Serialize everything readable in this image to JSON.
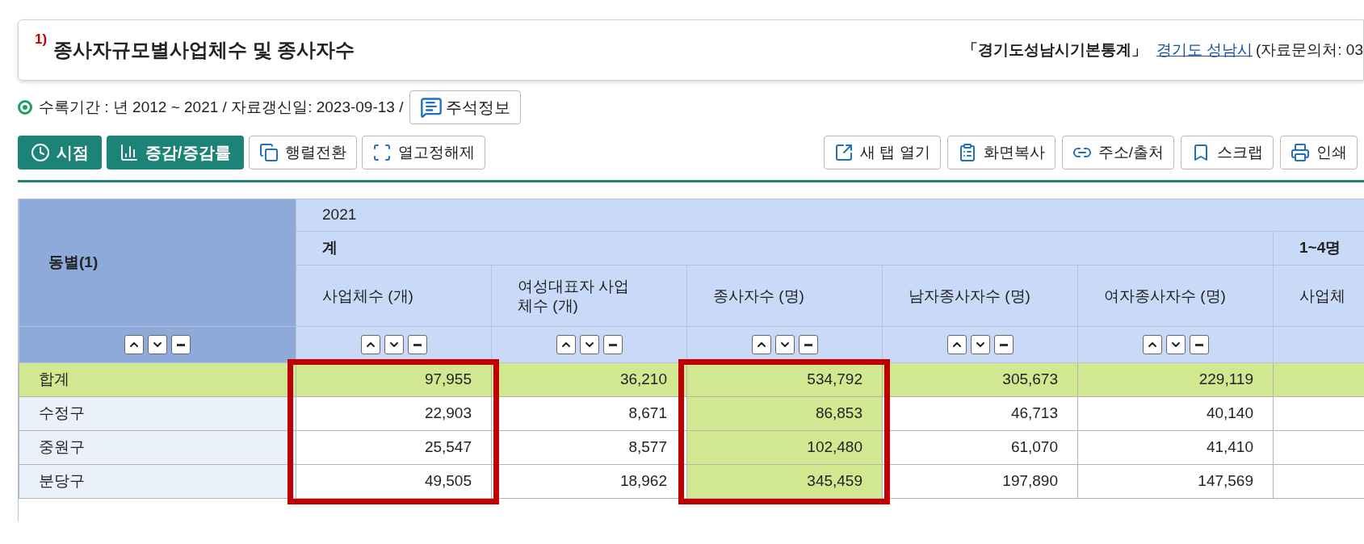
{
  "title": {
    "note": "1)",
    "text": "종사자규모별사업체수 및 종사자수",
    "source": "「경기도성남시기본통계」",
    "link": "경기도 성남시",
    "contact": "(자료문의처: 03"
  },
  "info": {
    "text": "수록기간 : 년 2012 ~ 2021 / 자료갱신일: 2023-09-13 /",
    "button": "주석정보"
  },
  "toolbar_left": [
    {
      "label": "시점",
      "kind": "primary"
    },
    {
      "label": "증감/증감률",
      "kind": "primary"
    },
    {
      "label": "행렬전환",
      "kind": "plain"
    },
    {
      "label": "열고정해제",
      "kind": "plain"
    }
  ],
  "toolbar_right": [
    {
      "label": "새 탭 열기"
    },
    {
      "label": "화면복사"
    },
    {
      "label": "주소/출처"
    },
    {
      "label": "스크랩"
    },
    {
      "label": "인쇄"
    }
  ],
  "table": {
    "row_header": "동별(1)",
    "year": "2021",
    "groups": [
      {
        "label": "계",
        "columns": [
          {
            "label": "사업체수 (개)",
            "boxed": true,
            "highlighted": false
          },
          {
            "label": "여성대표자 사업체수 (개)",
            "boxed": false,
            "highlighted": false
          },
          {
            "label": "종사자수 (명)",
            "boxed": true,
            "highlighted": true
          },
          {
            "label": "남자종사자수 (명)",
            "boxed": false,
            "highlighted": false
          },
          {
            "label": "여자종사자수 (명)",
            "boxed": false,
            "highlighted": false
          }
        ]
      },
      {
        "label": "1~4명",
        "columns": [
          {
            "label": "사업체",
            "boxed": false,
            "highlighted": false
          }
        ]
      }
    ],
    "rows": [
      {
        "name": "합계",
        "kind": "total",
        "values": [
          "97,955",
          "36,210",
          "534,792",
          "305,673",
          "229,119"
        ]
      },
      {
        "name": "수정구",
        "kind": "district",
        "values": [
          "22,903",
          "8,671",
          "86,853",
          "46,713",
          "40,140"
        ]
      },
      {
        "name": "중원구",
        "kind": "district",
        "values": [
          "25,547",
          "8,577",
          "102,480",
          "61,070",
          "41,410"
        ]
      },
      {
        "name": "분당구",
        "kind": "district",
        "values": [
          "49,505",
          "18,962",
          "345,459",
          "197,890",
          "147,569"
        ]
      }
    ]
  }
}
